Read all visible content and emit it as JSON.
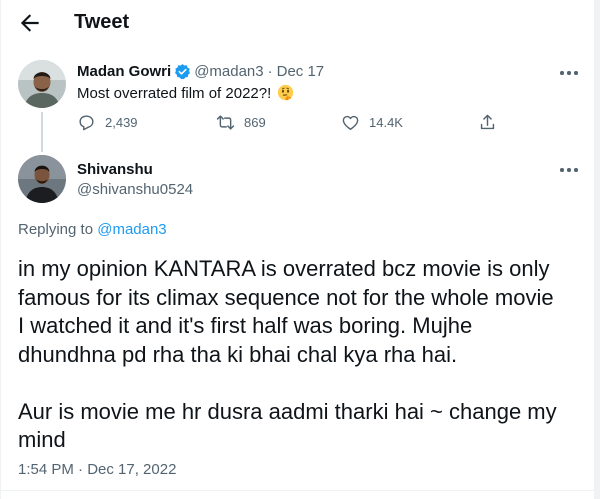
{
  "header": {
    "title": "Tweet",
    "back_icon": "arrow-left-icon"
  },
  "parent_tweet": {
    "author_name": "Madan Gowri",
    "verified": true,
    "handle": "@madan3",
    "separator": "·",
    "date": "Dec 17",
    "text": "Most overrated film of 2022?!",
    "emoji": "thinking-face-emoji",
    "stats": {
      "replies": "2,439",
      "retweets": "869",
      "likes": "14.4K"
    }
  },
  "reply_tweet": {
    "author_name": "Shivanshu",
    "handle": "@shivanshu0524",
    "replying_prefix": "Replying to ",
    "replying_mention": "@madan3",
    "body_lines": [
      "in my opinion KANTARA is overrated bcz movie is only",
      "famous for its climax sequence not for the whole movie",
      "I watched it and it's first half was boring. Mujhe",
      "dhundhna pd rha tha ki bhai chal kya rha hai.",
      "",
      "Aur is movie me hr dusra aadmi tharki hai ~ change my",
      "mind"
    ],
    "timestamp": "1:54 PM · Dec 17, 2022"
  },
  "colors": {
    "text": "#0f1419",
    "secondary": "#536471",
    "accent": "#1d9bf0",
    "border": "#eff3f4"
  }
}
